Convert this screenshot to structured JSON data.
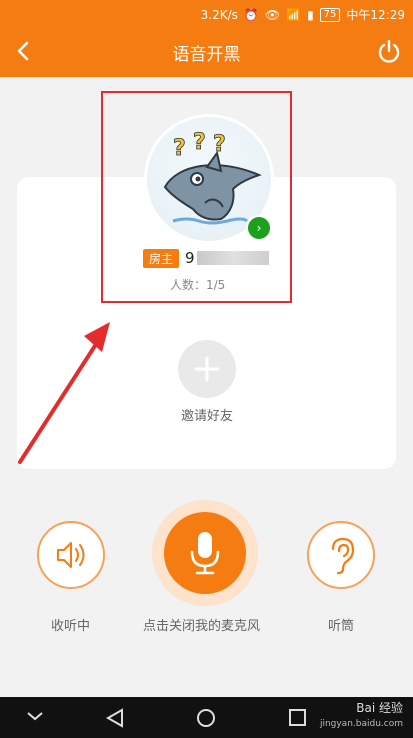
{
  "status_bar": {
    "speed": "3.2K/s",
    "battery": "75",
    "time": "中午12:29"
  },
  "header": {
    "title": "语音开黑"
  },
  "room": {
    "owner_badge": "房主",
    "owner_name_prefix": "9",
    "people_count": "人数：1/5",
    "invite_label": "邀请好友"
  },
  "controls": {
    "listening_label": "收听中",
    "mic_label": "点击关闭我的麦克风",
    "earpiece_label": "听筒"
  },
  "watermark": {
    "brand": "Bai 经验",
    "url": "jingyan.baidu.com"
  },
  "colors": {
    "accent": "#f57c10",
    "highlight": "#e52c2c",
    "online": "#1ba11b"
  }
}
